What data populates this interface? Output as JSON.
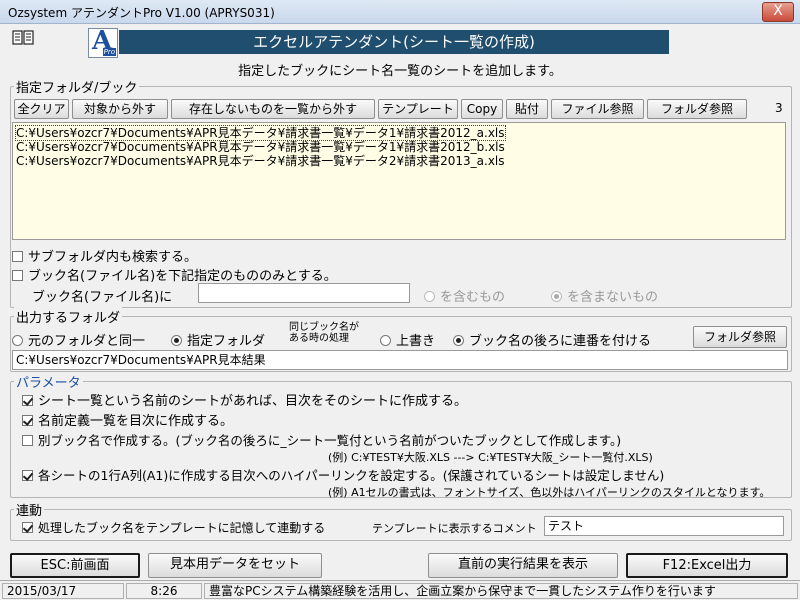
{
  "window": {
    "title": "Ozsystem アテンダントPro V1.00 (APRYS031)",
    "close": "X"
  },
  "header": {
    "logo_letter": "A",
    "logo_sub": "Pro",
    "banner": "エクセルアテンダント(シート一覧の作成)",
    "subtitle": "指定したブックにシート名一覧のシートを追加します。"
  },
  "folder_group": {
    "label": "指定フォルダ/ブック",
    "buttons": {
      "clear_all": "全クリア",
      "exclude": "対象から外す",
      "exclude_missing": "存在しないものを一覧から外す",
      "template": "テンプレート",
      "copy": "Copy",
      "paste": "貼付",
      "file_ref": "ファイル参照",
      "folder_ref": "フォルダ参照"
    },
    "count": "3",
    "files": [
      "C:¥Users¥ozcr7¥Documents¥APR見本データ¥請求書一覧¥データ1¥請求書2012_a.xls",
      "C:¥Users¥ozcr7¥Documents¥APR見本データ¥請求書一覧¥データ1¥請求書2012_b.xls",
      "C:¥Users¥ozcr7¥Documents¥APR見本データ¥請求書一覧¥データ2¥請求書2013_a.xls"
    ],
    "subfolder_search": "サブフォルダ内も検索する。",
    "book_filter": "ブック名(ファイル名)を下記指定のもののみとする。",
    "book_name_label": "ブック名(ファイル名)に",
    "book_name_value": "",
    "contains": "を含むもの",
    "not_contains": "を含まないもの"
  },
  "output_group": {
    "label": "出力するフォルダ",
    "same_folder": "元のフォルダと同一",
    "specified_folder": "指定フォルダ",
    "same_name_note_1": "同じブック名が",
    "same_name_note_2": "ある時の処理",
    "overwrite": "上書き",
    "append_number": "ブック名の後ろに連番を付ける",
    "folder_ref": "フォルダ参照",
    "path": "C:¥Users¥ozcr7¥Documents¥APR見本結果"
  },
  "param_group": {
    "label": "パラメータ",
    "opt1": "シート一覧という名前のシートがあれば、目次をそのシートに作成する。",
    "opt2": "名前定義一覧を目次に作成する。",
    "opt3": "別ブック名で作成する。(ブック名の後ろに_シート一覧付という名前がついたブックとして作成します。)",
    "opt3_example": "(例)  C:¥TEST¥大阪.XLS  --->  C:¥TEST¥大阪_シート一覧付.XLS)",
    "opt4": "各シートの1行A列(A1)に作成する目次へのハイパーリンクを設定する。(保護されているシートは設定しません)",
    "opt4_example": "(例)  A1セルの書式は、フォントサイズ、色以外はハイパーリンクのスタイルとなります。"
  },
  "link_group": {
    "label": "連動",
    "remember": "処理したブック名をテンプレートに記憶して連動する",
    "comment_label": "テンプレートに表示するコメント",
    "comment_value": "テスト"
  },
  "footer_buttons": {
    "esc": "ESC:前画面",
    "sample": "見本用データをセット",
    "last_result": "直前の実行結果を表示",
    "f12": "F12:Excel出力"
  },
  "status": {
    "date": "2015/03/17",
    "time": "8:26",
    "message": "豊富なPCシステム構築経験を活用し、企画立案から保守まで一貫したシステム作りを行います"
  },
  "colors": {
    "banner_bg": "#1f4e6e",
    "list_bg": "#fffde6",
    "accent": "#1b4fa0"
  }
}
